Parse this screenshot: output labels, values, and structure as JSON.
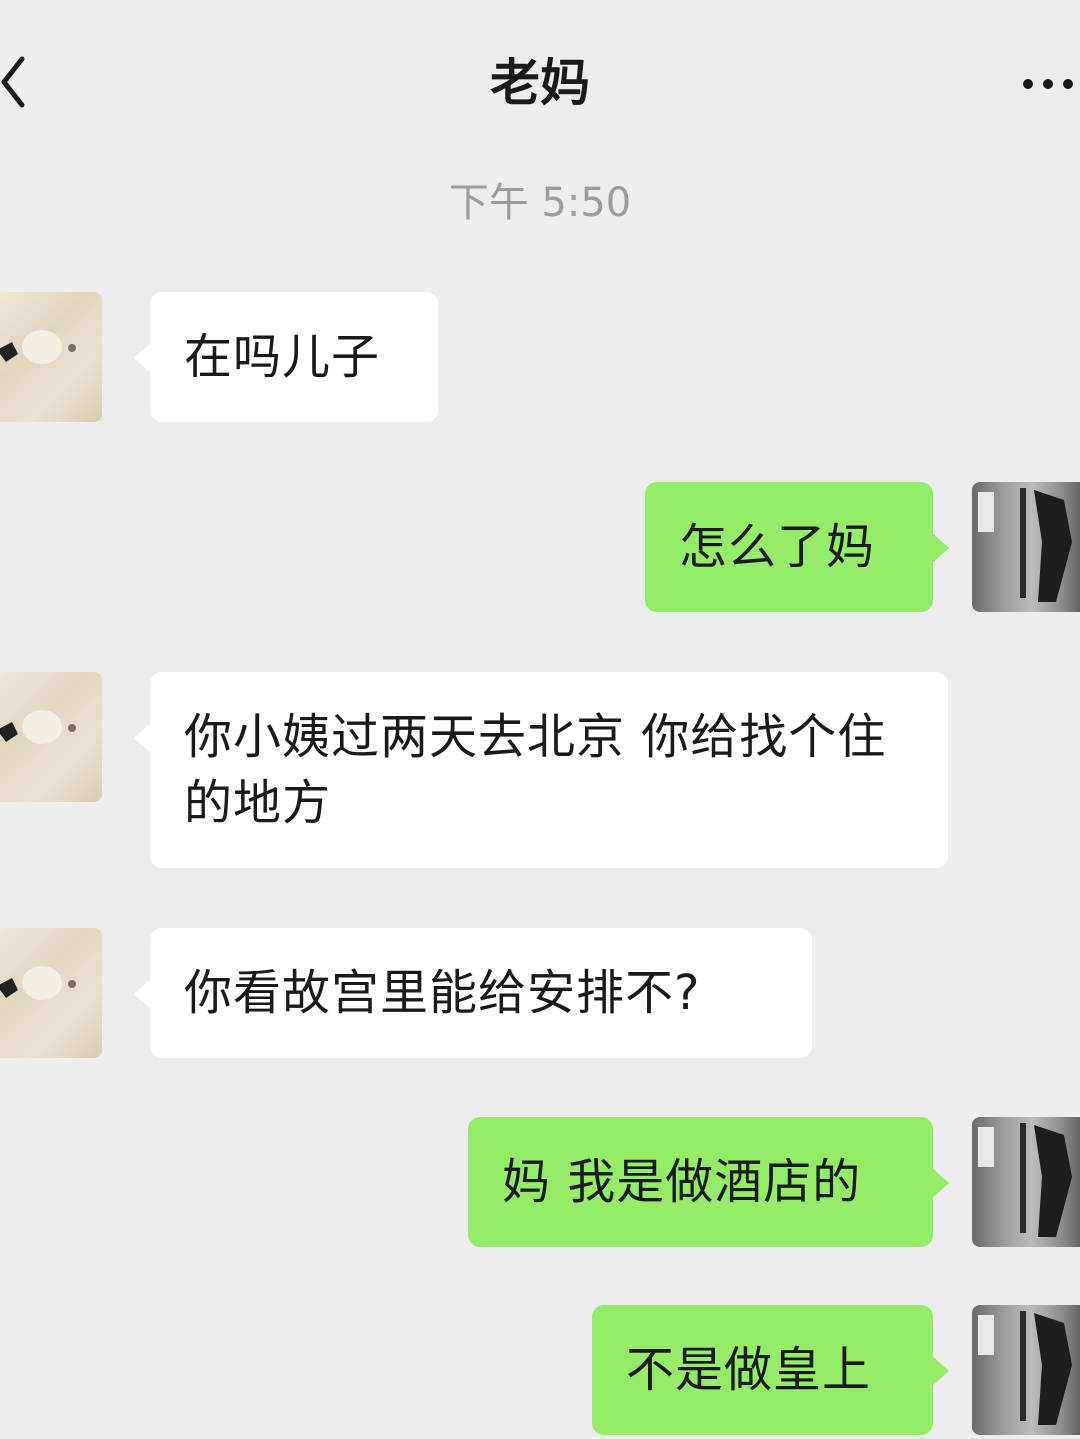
{
  "header": {
    "title": "老妈",
    "back_icon": "chevron-left-icon",
    "more_icon": "more-dots-icon"
  },
  "timestamp": "下午 5:50",
  "messages": [
    {
      "side": "left",
      "text": "在吗儿子"
    },
    {
      "side": "right",
      "text": "怎么了妈"
    },
    {
      "side": "left",
      "text": "你小姨过两天去北京 你给找个住的地方"
    },
    {
      "side": "left",
      "text": "你看故宫里能给安排不?"
    },
    {
      "side": "right",
      "text": "妈 我是做酒店的"
    },
    {
      "side": "right",
      "text": "不是做皇上"
    }
  ],
  "colors": {
    "background": "#ededed",
    "bubble_self": "#95ec69",
    "bubble_other": "#ffffff",
    "timestamp_text": "#9c9c9c"
  }
}
